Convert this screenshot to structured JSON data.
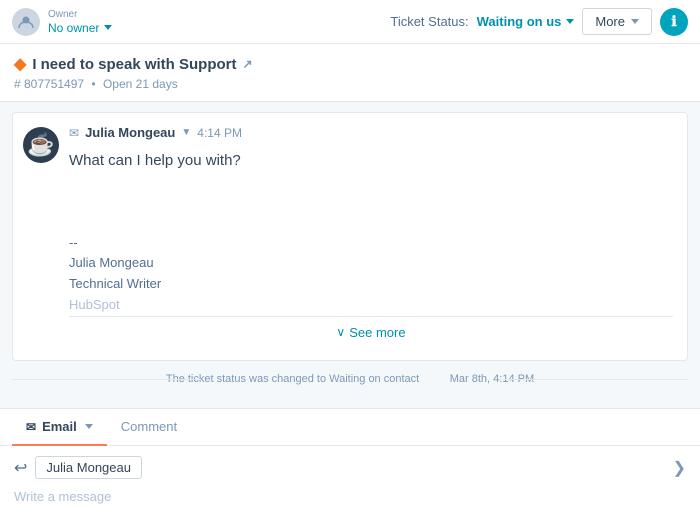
{
  "topbar": {
    "owner_label": "Owner",
    "owner_name": "No owner",
    "ticket_status_label": "Ticket Status:",
    "ticket_status_value": "Waiting on us",
    "more_button": "More",
    "info_icon": "ℹ"
  },
  "ticket": {
    "icon": "◆",
    "title": "I need to speak with Support",
    "external_link": "↗",
    "ticket_number": "# 807751497",
    "open_days": "Open 21 days"
  },
  "message": {
    "email_icon": "✉",
    "sender": "Julia Mongeau",
    "arrow": "▼",
    "time": "4:14 PM",
    "body": "What can I help you with?",
    "signature_dash": "--",
    "signature_name": "Julia Mongeau",
    "signature_title": "Technical Writer",
    "signature_company": "HubSpot",
    "see_more": "See more"
  },
  "status_change": {
    "text": "The ticket status was changed to Waiting on contact  Mar 8th, 4:14 PM"
  },
  "reply": {
    "email_tab": "Email",
    "comment_tab": "Comment",
    "back_icon": "↩",
    "recipient": "Julia Mongeau",
    "collapse_icon": "❯",
    "placeholder": "Write a message"
  }
}
